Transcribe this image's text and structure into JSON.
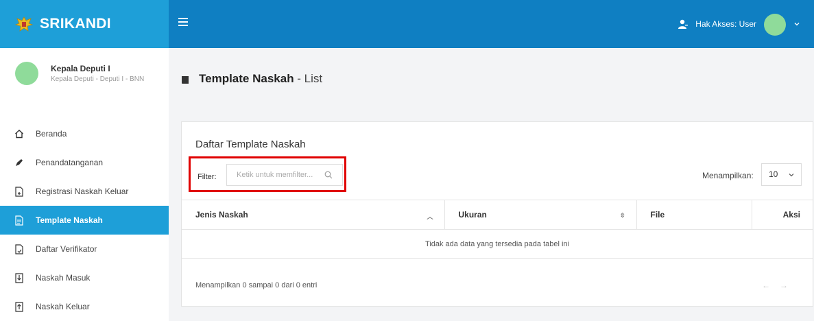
{
  "brand": {
    "name": "SRIKANDI"
  },
  "topbar": {
    "access_label": "Hak Akses: User"
  },
  "profile": {
    "name": "Kepala Deputi I",
    "role": "Kepala Deputi - Deputi I - BNN"
  },
  "sidebar": {
    "items": [
      {
        "label": "Beranda",
        "icon": "home-icon"
      },
      {
        "label": "Penandatanganan",
        "icon": "pen-icon"
      },
      {
        "label": "Registrasi Naskah Keluar",
        "icon": "file-plus-icon"
      },
      {
        "label": "Template Naskah",
        "icon": "file-text-icon",
        "active": true
      },
      {
        "label": "Daftar Verifikator",
        "icon": "file-check-icon"
      },
      {
        "label": "Naskah Masuk",
        "icon": "inbox-down-icon"
      },
      {
        "label": "Naskah Keluar",
        "icon": "outbox-up-icon"
      }
    ]
  },
  "page": {
    "title": "Template Naskah",
    "subtitle": " - List"
  },
  "panel": {
    "title": "Daftar Template Naskah",
    "filter_label": "Filter:",
    "filter_placeholder": "Ketik untuk memfilter...",
    "show_label": "Menampilkan:",
    "show_value": "10",
    "columns": [
      "Jenis Naskah",
      "Ukuran",
      "File",
      "Aksi"
    ],
    "empty_text": "Tidak ada data yang tersedia pada tabel ini",
    "info_text": "Menampilkan 0 sampai 0 dari 0 entri",
    "pager_prev": "←",
    "pager_next": "→"
  },
  "colors": {
    "brand": "#1e9fd8",
    "topbar": "#0f7fc2",
    "highlight": "#e00000",
    "avatar": "#8fdb9a"
  }
}
